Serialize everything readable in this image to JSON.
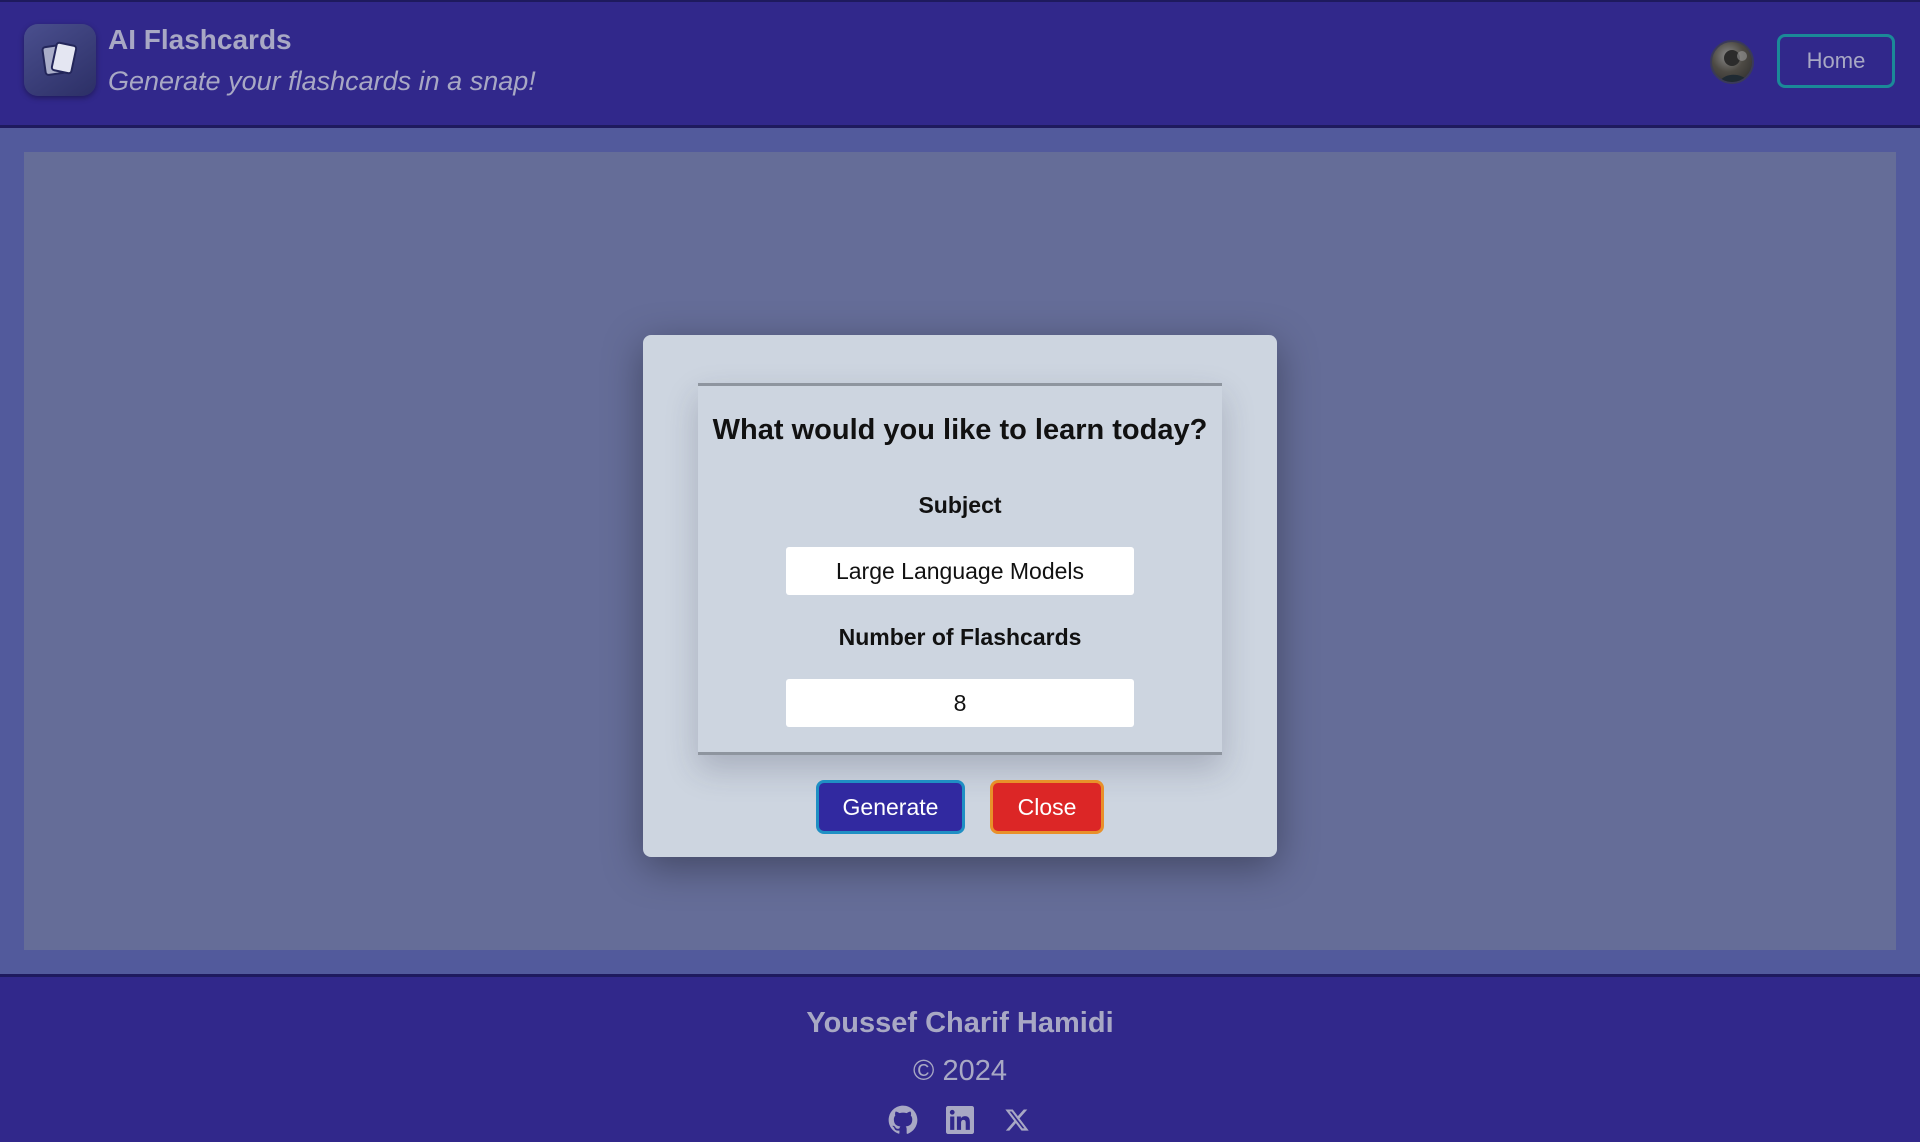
{
  "header": {
    "title": "AI Flashcards",
    "subtitle": "Generate your flashcards in a snap!",
    "home_label": "Home"
  },
  "dialog": {
    "heading": "What would you like to learn today?",
    "subject_label": "Subject",
    "subject_value": "Large Language Models",
    "count_label": "Number of Flashcards",
    "count_value": "8",
    "generate_label": "Generate",
    "close_label": "Close"
  },
  "footer": {
    "author": "Youssef Charif Hamidi",
    "copyright": "© 2024",
    "social_icons": [
      "github-icon",
      "linkedin-icon",
      "x-icon"
    ]
  },
  "colors": {
    "header_bg": "#31288b",
    "backdrop": "#656d98",
    "dialog_bg": "#cdd5e0",
    "generate_bg": "#3129a0",
    "close_bg": "#dc2626",
    "home_border": "#1b8a98"
  }
}
